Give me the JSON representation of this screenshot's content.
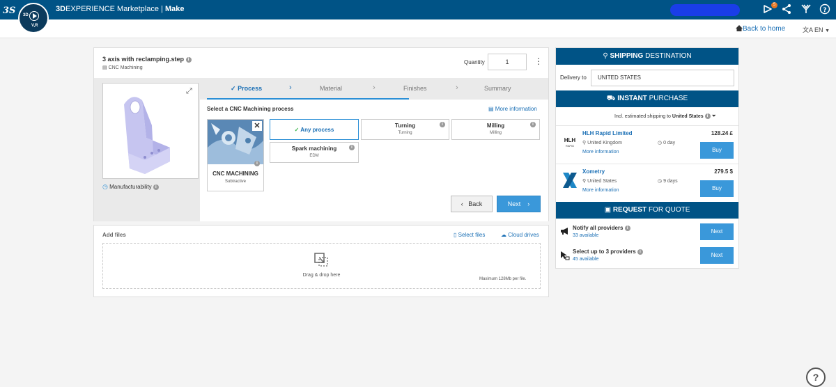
{
  "app": {
    "brand_prefix": "3D",
    "brand_name": "EXPERIENCE Marketplace",
    "separator": "|",
    "module": "Make",
    "compass": {
      "label_3d": "3D",
      "label_vr": "V,R"
    },
    "notification_count": "5",
    "icons": [
      "ds-logo-icon",
      "compass-icon",
      "notification-icon",
      "share-icon",
      "tools-icon",
      "help-icon"
    ]
  },
  "subbar": {
    "back_home": "Back to home",
    "language": "EN"
  },
  "part": {
    "file_name": "3 axis with reclamping.step",
    "technology": "CNC Machining",
    "quantity_label": "Quantity",
    "quantity": "1",
    "manufacturability": "Manufacturability"
  },
  "steps": [
    {
      "label": "Process",
      "active": true
    },
    {
      "label": "Material",
      "active": false
    },
    {
      "label": "Finishes",
      "active": false
    },
    {
      "label": "Summary",
      "active": false
    }
  ],
  "process": {
    "title": "Select a CNC Machining process",
    "more_info": "More information",
    "card": {
      "title": "CNC MACHINING",
      "subtitle": "Subtractive"
    },
    "options": [
      {
        "title": "Any process",
        "subtitle": "",
        "selected": true
      },
      {
        "title": "Turning",
        "subtitle": "Turning",
        "selected": false
      },
      {
        "title": "Milling",
        "subtitle": "Milling",
        "selected": false
      },
      {
        "title": "Spark machining",
        "subtitle": "EDM",
        "selected": false
      }
    ],
    "back_label": "Back",
    "next_label": "Next"
  },
  "files": {
    "title": "Add files",
    "select_files": "Select files",
    "cloud_drives": "Cloud drives",
    "drop_text": "Drag & drop here",
    "max_text": "Maximum 128Mb per file."
  },
  "shipping": {
    "title_bold": "SHIPPING",
    "title_rest": "DESTINATION",
    "delivery_label": "Delivery to",
    "delivery_value": "UNITED STATES"
  },
  "instant": {
    "title_bold": "INSTANT",
    "title_rest": "PURCHASE",
    "note_prefix": "Incl. estimated shipping to",
    "note_country": "United States",
    "providers": [
      {
        "name": "HLH Rapid Limited",
        "logo_text": "HLH",
        "logo_sub": "RAPID",
        "price": "128.24 £",
        "country": "United Kingdom",
        "days": "0 day",
        "more": "More information",
        "buy": "Buy"
      },
      {
        "name": "Xometry",
        "logo_text": "X",
        "price": "279.5 $",
        "country": "United States",
        "days": "9 days",
        "more": "More information",
        "buy": "Buy"
      }
    ]
  },
  "rfq": {
    "title_bold": "REQUEST",
    "title_rest": "FOR QUOTE",
    "rows": [
      {
        "title": "Notify all providers",
        "available": "33 available",
        "button": "Next"
      },
      {
        "title": "Select up to 3 providers",
        "available": "45 available",
        "button": "Next"
      }
    ]
  },
  "colors": {
    "header_blue": "#005386",
    "accent_blue": "#3a98da",
    "link_blue": "#1a6fb5",
    "check_green": "#3bb54a"
  }
}
